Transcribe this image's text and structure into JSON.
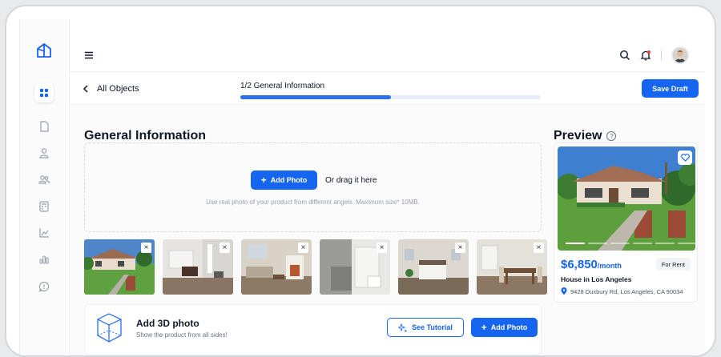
{
  "topbar": {
    "menu_icon": "hamburger-icon",
    "search_icon": "search-icon",
    "bell_icon": "bell-icon",
    "notification_color": "#ef4444"
  },
  "subbar": {
    "back_label": "All Objects",
    "progress_label": "1/2 General Information",
    "progress_fraction": 0.5,
    "save_label": "Save Draft"
  },
  "main": {
    "title": "General Information",
    "dropzone": {
      "add_label": "Add Photo",
      "drag_label": "Or drag it here",
      "hint": "Use real photo of your product from different angels. Maximum size* 10MB."
    },
    "photos": [
      {
        "kind": "house-exterior"
      },
      {
        "kind": "living-room"
      },
      {
        "kind": "living-room-fireplace"
      },
      {
        "kind": "bathroom"
      },
      {
        "kind": "bedroom"
      },
      {
        "kind": "dining-room"
      }
    ],
    "photo3d": {
      "title": "Add 3D photo",
      "subtitle": "Show the product from all sides!",
      "tutorial_label": "See Tutorial",
      "add_label": "Add Photo"
    }
  },
  "preview": {
    "title": "Preview",
    "price": "$6,850",
    "price_unit": "/month",
    "badge": "For Rent",
    "name": "House in Los Angeles",
    "address": "9428 Duxbury Rd, Los Angeles, CA 90034"
  },
  "colors": {
    "accent": "#1565f0"
  }
}
